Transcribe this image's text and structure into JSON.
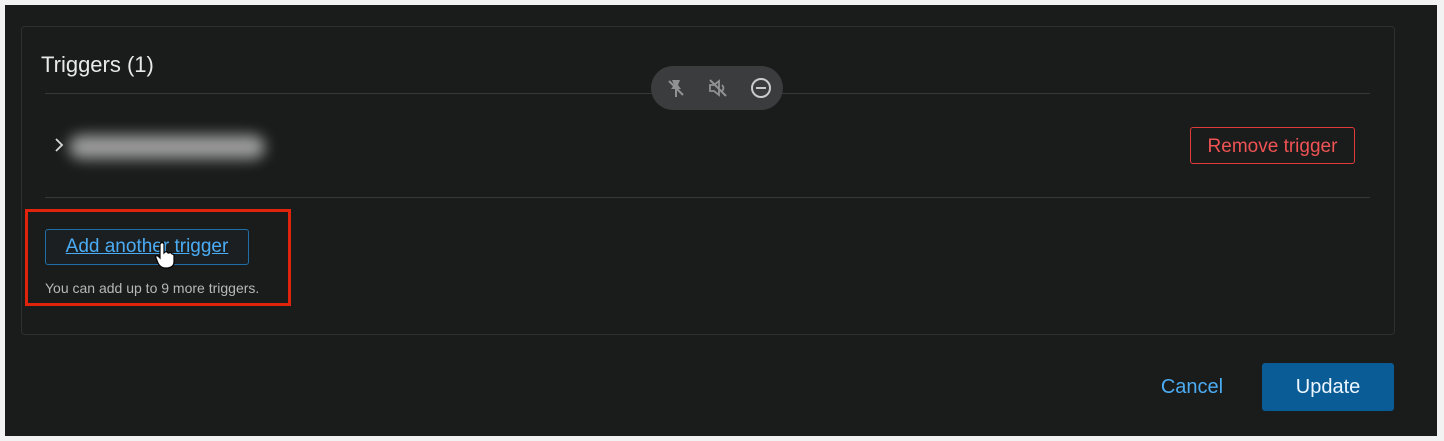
{
  "panel": {
    "title": "Triggers (1)"
  },
  "floating_toolbar": {
    "icons": [
      "unpin-icon",
      "mute-icon",
      "minus-circle-icon"
    ]
  },
  "trigger_row": {
    "name_blurred": true,
    "remove_label": "Remove trigger"
  },
  "add_section": {
    "button_label": "Add another trigger",
    "hint": "You can add up to 9 more triggers."
  },
  "footer": {
    "cancel_label": "Cancel",
    "update_label": "Update"
  },
  "colors": {
    "background": "#1a1b1b",
    "accent_blue": "#4bacf3",
    "danger_red": "#ef5353",
    "primary_button": "#0a5c96",
    "highlight_box": "#e0230b"
  }
}
